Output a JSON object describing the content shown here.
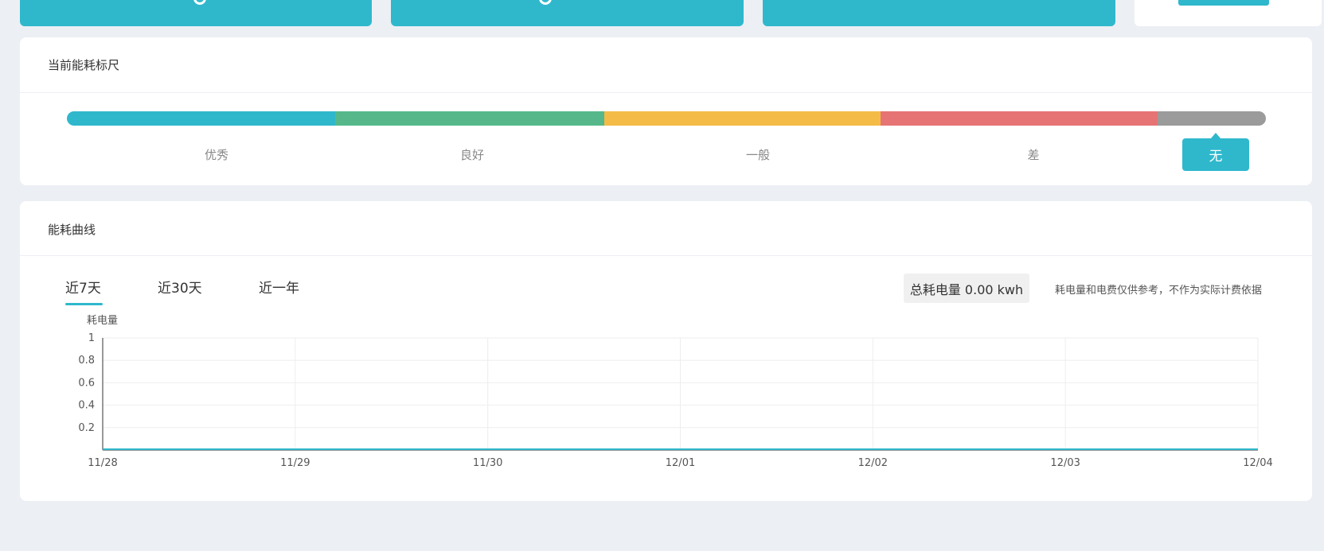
{
  "colors": {
    "accent": "#2fb8cc",
    "excellent": "#2fb8cc",
    "good": "#56b88a",
    "average": "#f4bc47",
    "poor": "#e67474",
    "none": "#9b9b9b"
  },
  "scale_panel": {
    "title": "当前能耗标尺",
    "levels": [
      "优秀",
      "良好",
      "一般",
      "差"
    ],
    "current_level": "无"
  },
  "curve_panel": {
    "title": "能耗曲线",
    "tabs": [
      {
        "label": "近7天",
        "active": true
      },
      {
        "label": "近30天",
        "active": false
      },
      {
        "label": "近一年",
        "active": false
      }
    ],
    "total_label": "总耗电量 0.00 kwh",
    "note": "耗电量和电费仅供参考，不作为实际计费依据"
  },
  "chart_data": {
    "type": "line",
    "ylabel": "耗电量",
    "categories": [
      "11/28",
      "11/29",
      "11/30",
      "12/01",
      "12/02",
      "12/03",
      "12/04"
    ],
    "y_ticks": [
      "0.2",
      "0.4",
      "0.6",
      "0.8",
      "1"
    ],
    "ylim": [
      0,
      1
    ],
    "grid": true,
    "series": [
      {
        "values": [
          0,
          0,
          0,
          0,
          0,
          0,
          0
        ],
        "color": "#2fb8cc"
      }
    ]
  }
}
